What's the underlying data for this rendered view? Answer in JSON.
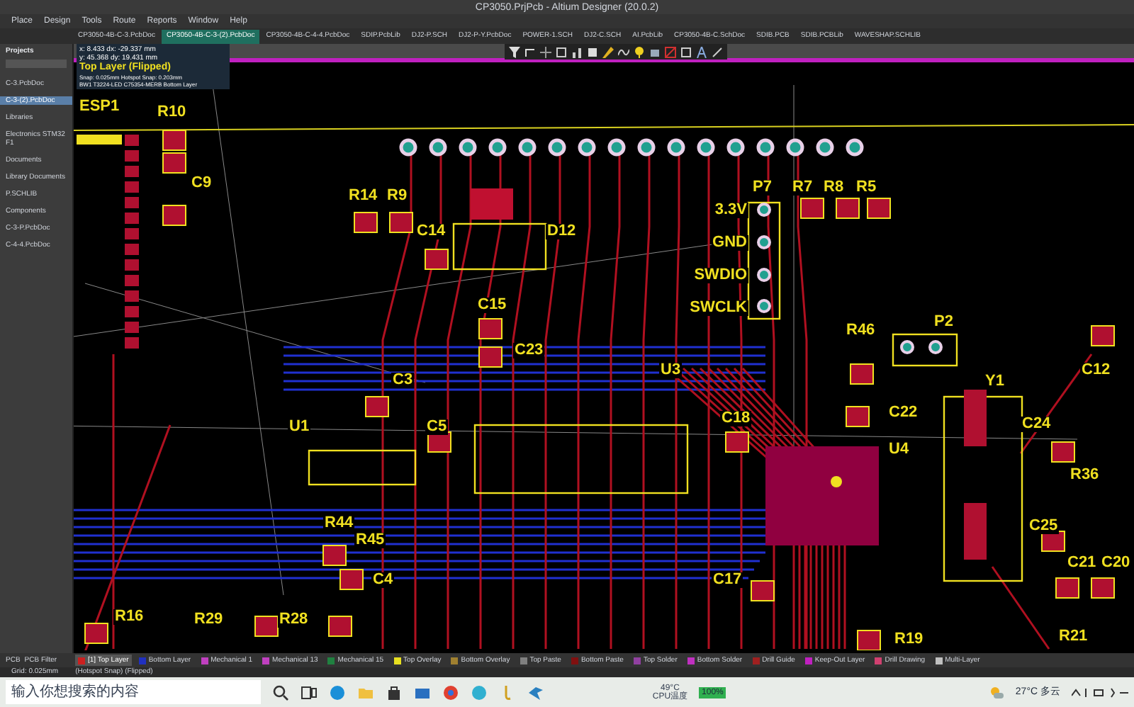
{
  "window": {
    "title": "CP3050.PrjPcb - Altium Designer (20.0.2)"
  },
  "menu": [
    "Place",
    "Design",
    "Tools",
    "Route",
    "Reports",
    "Window",
    "Help"
  ],
  "tabs": [
    {
      "label": "CP3050-4B-C-3.PcbDoc",
      "selected": false
    },
    {
      "label": "CP3050-4B-C-3-(2).PcbDoc",
      "selected": true
    },
    {
      "label": "CP3050-4B-C-4-4.PcbDoc",
      "selected": false
    },
    {
      "label": "SDIP.PcbLib",
      "selected": false
    },
    {
      "label": "DJ2-P.SCH",
      "selected": false
    },
    {
      "label": "DJ2-P-Y.PcbDoc",
      "selected": false
    },
    {
      "label": "POWER-1.SCH",
      "selected": false
    },
    {
      "label": "DJ2-C.SCH",
      "selected": false
    },
    {
      "label": "AI.PcbLib",
      "selected": false
    },
    {
      "label": "CP3050-4B-C.SchDoc",
      "selected": false
    },
    {
      "label": "SDIB.PCB",
      "selected": false
    },
    {
      "label": "SDIB.PCBLib",
      "selected": false
    },
    {
      "label": "WAVESHAP.SCHLIB",
      "selected": false
    }
  ],
  "projects_panel": {
    "title": "Projects",
    "items": [
      {
        "label": "C-3.PcbDoc",
        "selected": false
      },
      {
        "label": "C-3-(2).PcbDoc",
        "selected": true
      },
      {
        "label": "Libraries",
        "selected": false
      },
      {
        "label": "Electronics STM32 F1",
        "selected": false
      },
      {
        "label": "Documents",
        "selected": false
      },
      {
        "label": "Library Documents",
        "selected": false
      },
      {
        "label": "P.SCHLIB",
        "selected": false
      },
      {
        "label": "Components",
        "selected": false
      },
      {
        "label": "C-3-P.PcbDoc",
        "selected": false
      },
      {
        "label": "C-4-4.PcbDoc",
        "selected": false
      }
    ],
    "footer_tabs": [
      "PCB",
      "PCB Filter"
    ]
  },
  "info_overlay": {
    "coords_x": "x: 8.433   dx: -29.337 mm",
    "coords_y": "y: 45.368   dy: 19.431 mm",
    "layer": "Top Layer (Flipped)",
    "snap": "Snap: 0.025mm Hotspot Snap: 0.203mm",
    "component": "BW1 T3224-LED C75354-MERB Bottom Layer"
  },
  "components": [
    {
      "label": "ESP1"
    },
    {
      "label": "R10"
    },
    {
      "label": "C9"
    },
    {
      "label": "R14"
    },
    {
      "label": "R9"
    },
    {
      "label": "C14"
    },
    {
      "label": "D12"
    },
    {
      "label": "C15"
    },
    {
      "label": "C23"
    },
    {
      "label": "P7"
    },
    {
      "label": "R7"
    },
    {
      "label": "R8"
    },
    {
      "label": "R5"
    },
    {
      "label": "U3"
    },
    {
      "label": "R46"
    },
    {
      "label": "P2"
    },
    {
      "label": "Y1"
    },
    {
      "label": "C3"
    },
    {
      "label": "U1"
    },
    {
      "label": "C5"
    },
    {
      "label": "C18"
    },
    {
      "label": "C22"
    },
    {
      "label": "U4"
    },
    {
      "label": "C24"
    },
    {
      "label": "R36"
    },
    {
      "label": "C25"
    },
    {
      "label": "C21"
    },
    {
      "label": "C20"
    },
    {
      "label": "R44"
    },
    {
      "label": "R45"
    },
    {
      "label": "C4"
    },
    {
      "label": "C17"
    },
    {
      "label": "R16"
    },
    {
      "label": "R29"
    },
    {
      "label": "R28"
    },
    {
      "label": "R21"
    },
    {
      "label": "R19"
    },
    {
      "label": "C12"
    }
  ],
  "p7_pin_labels": [
    "3.3V",
    "GND",
    "SWDIO",
    "SWCLK"
  ],
  "layer_tabs": [
    {
      "label": "[1] Top Layer",
      "color": "#cc2020",
      "selected": true
    },
    {
      "label": "Bottom Layer",
      "color": "#2030c0",
      "selected": false
    },
    {
      "label": "Mechanical 1",
      "color": "#c040c0",
      "selected": false
    },
    {
      "label": "Mechanical 13",
      "color": "#c040c0",
      "selected": false
    },
    {
      "label": "Mechanical 15",
      "color": "#208040",
      "selected": false
    },
    {
      "label": "Top Overlay",
      "color": "#e8e020",
      "selected": false
    },
    {
      "label": "Bottom Overlay",
      "color": "#a08030",
      "selected": false
    },
    {
      "label": "Top Paste",
      "color": "#808080",
      "selected": false
    },
    {
      "label": "Bottom Paste",
      "color": "#801010",
      "selected": false
    },
    {
      "label": "Top Solder",
      "color": "#9040a0",
      "selected": false
    },
    {
      "label": "Bottom Solder",
      "color": "#c030c0",
      "selected": false
    },
    {
      "label": "Drill Guide",
      "color": "#a02020",
      "selected": false
    },
    {
      "label": "Keep-Out Layer",
      "color": "#c020c0",
      "selected": false
    },
    {
      "label": "Drill Drawing",
      "color": "#d04070",
      "selected": false
    },
    {
      "label": "Multi-Layer",
      "color": "#c0c0c0",
      "selected": false
    }
  ],
  "status_bar": {
    "grid": "Grid: 0.025mm",
    "snap": "(Hotspot Snap) (Flipped)"
  },
  "taskbar": {
    "search_placeholder": "输入你想搜索的内容",
    "cpu_temp": "49°C",
    "cpu_label": "CPU温度",
    "battery": "100%",
    "weather": "27°C 多云"
  }
}
